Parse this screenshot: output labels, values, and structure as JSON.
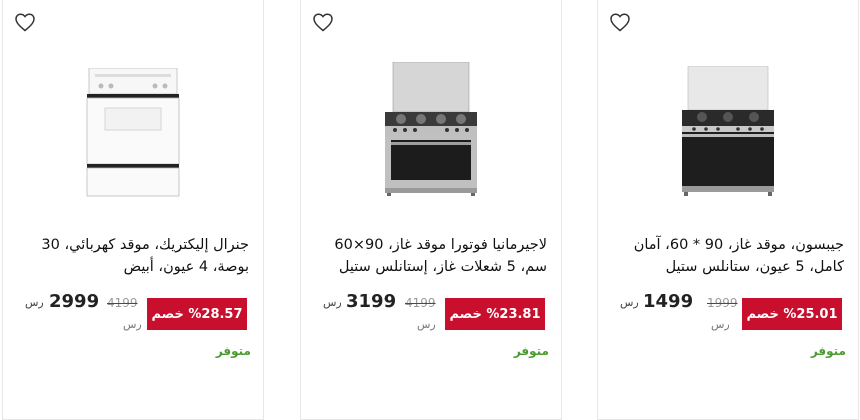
{
  "products": [
    {
      "title": "جيبسون، موقد غاز، 90 * 60، آمان كامل، 5 عيون، ستانلس ستيل",
      "discount": "%25.01 خصم",
      "old_price": "1999",
      "old_currency": "رس",
      "price": "1499",
      "currency": "رس",
      "stock": "متوفر",
      "wishlist_icon": "heart-outline-icon"
    },
    {
      "title": "لاجيرمانيا فوتورا موقد غاز، 90×60 سم، 5 شعلات غاز، إستانلس ستيل",
      "discount": "%23.81 خصم",
      "old_price": "4199",
      "old_currency": "رس",
      "price": "3199",
      "currency": "رس",
      "stock": "متوفر",
      "wishlist_icon": "heart-outline-icon"
    },
    {
      "title": "جنرال إليكتريك، موقد كهربائي، 30 بوصة، 4 عيون، أبيض",
      "discount": "%28.57 خصم",
      "old_price": "4199",
      "old_currency": "رس",
      "price": "2999",
      "currency": "رس",
      "stock": "متوفر",
      "wishlist_icon": "heart-outline-icon"
    }
  ],
  "colors": {
    "discount_bg": "#c8102e",
    "stock_text": "#4a9b2f",
    "card_border": "#e6e6e6"
  }
}
